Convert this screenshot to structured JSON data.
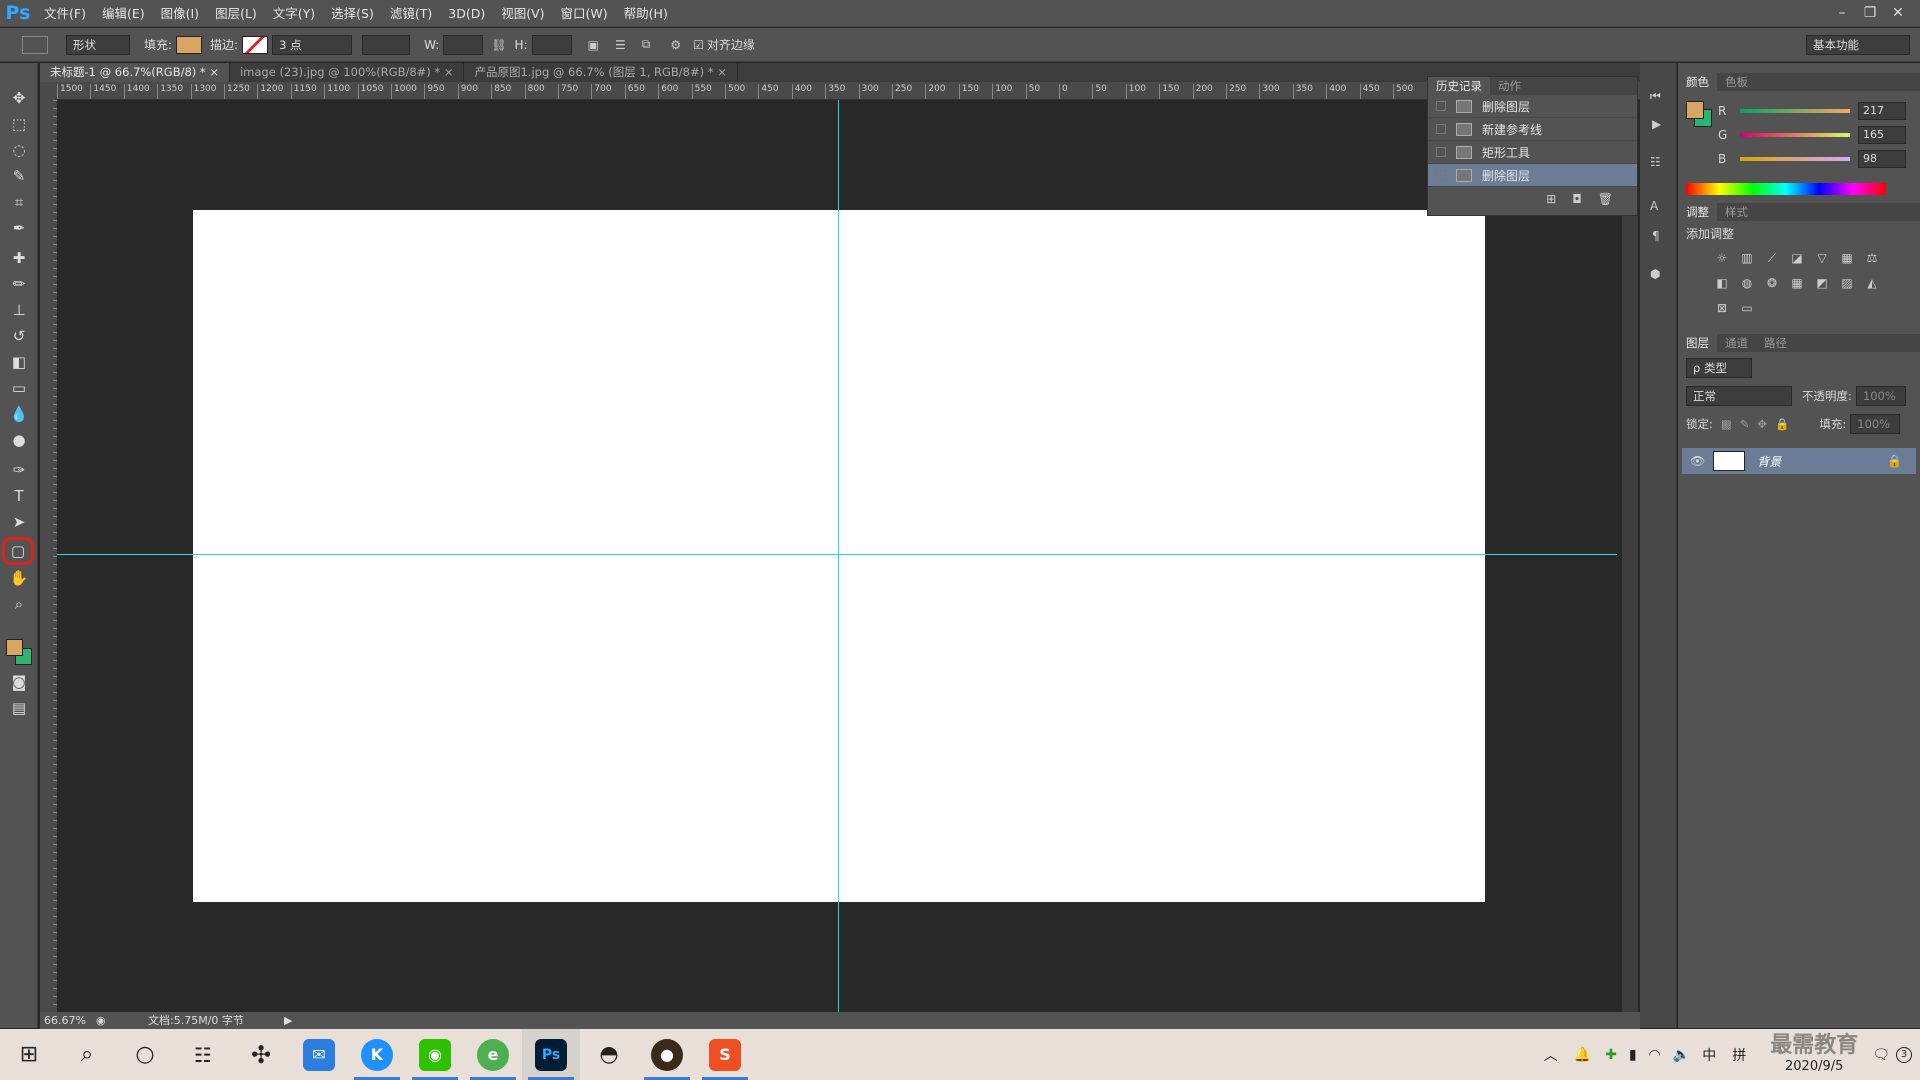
{
  "menubar": {
    "logo": "Ps",
    "items": [
      "文件(F)",
      "编辑(E)",
      "图像(I)",
      "图层(L)",
      "文字(Y)",
      "选择(S)",
      "滤镜(T)",
      "3D(D)",
      "视图(V)",
      "窗口(W)",
      "帮助(H)"
    ],
    "controls": [
      "–",
      "❐",
      "✕"
    ]
  },
  "options": {
    "mode": "形状",
    "fill_label": "填充:",
    "fill_color": "#d9a562",
    "stroke_label": "描边:",
    "stroke_size": "3 点",
    "w_label": "W:",
    "h_label": "H:",
    "align_edges": "对齐边缘",
    "workspace": "基本功能"
  },
  "tabs": [
    "未标题-1 @ 66.7%(RGB/8) *",
    "image (23).jpg @ 100%(RGB/8#) *",
    "产品原图1.jpg @ 66.7% (图层 1, RGB/8#) *"
  ],
  "ruler": {
    "h": [
      "1500",
      "1450",
      "1400",
      "1350",
      "1300",
      "1250",
      "1200",
      "1150",
      "1100",
      "1050",
      "1000",
      "950",
      "900",
      "850",
      "800",
      "750",
      "700",
      "650",
      "600",
      "550",
      "500",
      "450",
      "400",
      "350",
      "300",
      "250",
      "200",
      "150",
      "100",
      "50",
      "0",
      "50",
      "100",
      "150",
      "200",
      "250",
      "300",
      "350",
      "400",
      "450",
      "500"
    ]
  },
  "status": {
    "zoom": "66.67%",
    "doc": "文档:5.75M/0 字节"
  },
  "history": {
    "tabs": [
      "历史记录",
      "动作"
    ],
    "rows": [
      "删除图层",
      "新建参考线",
      "矩形工具",
      "删除图层"
    ]
  },
  "color": {
    "tabs": [
      "颜色",
      "色板"
    ],
    "r_label": "R",
    "g_label": "G",
    "b_label": "B",
    "r": "217",
    "g": "165",
    "b": "98",
    "fg": "#d9a562",
    "bg": "#2bb56f"
  },
  "adjust": {
    "tabs": [
      "调整",
      "样式"
    ],
    "title": "添加调整"
  },
  "layers": {
    "tabs": [
      "图层",
      "通道",
      "路径"
    ],
    "kind": "ρ 类型",
    "blend": "正常",
    "opacity_label": "不透明度:",
    "opacity": "100%",
    "lock_label": "锁定:",
    "fill_label": "填充:",
    "fill": "100%",
    "layer_name": "背景"
  },
  "taskbar": {
    "ime": "中",
    "ime2": "拼",
    "date": "2020/9/5",
    "badge": "3",
    "watermark": "最需教育"
  }
}
